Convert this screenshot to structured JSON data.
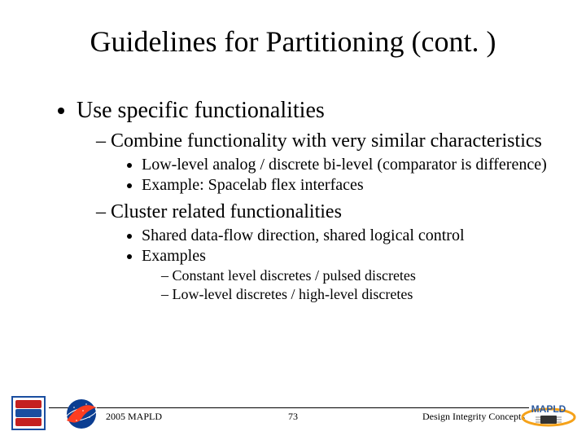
{
  "title": "Guidelines for Partitioning (cont. )",
  "bullets": {
    "b1": "Use specific functionalities",
    "b1_1": "Combine functionality with very similar characteristics",
    "b1_1_1": "Low-level analog / discrete bi-level (comparator is difference)",
    "b1_1_2": "Example: Spacelab flex interfaces",
    "b1_2": "Cluster related functionalities",
    "b1_2_1": "Shared data-flow direction, shared logical control",
    "b1_2_2": "Examples",
    "b1_2_2_1": "Constant level discretes / pulsed discretes",
    "b1_2_2_2": "Low-level discretes / high-level discretes"
  },
  "footer": {
    "left": "2005 MAPLD",
    "center": "73",
    "right": "Design Integrity Concepts"
  },
  "logos": {
    "svr": "SVR",
    "nasa": "NASA",
    "mapld": "MAPLD"
  },
  "colors": {
    "nasa_blue": "#0b3d91",
    "nasa_red": "#fc3d21",
    "mapld_orange": "#f5a21a",
    "mapld_label": "#2c5aa0"
  }
}
